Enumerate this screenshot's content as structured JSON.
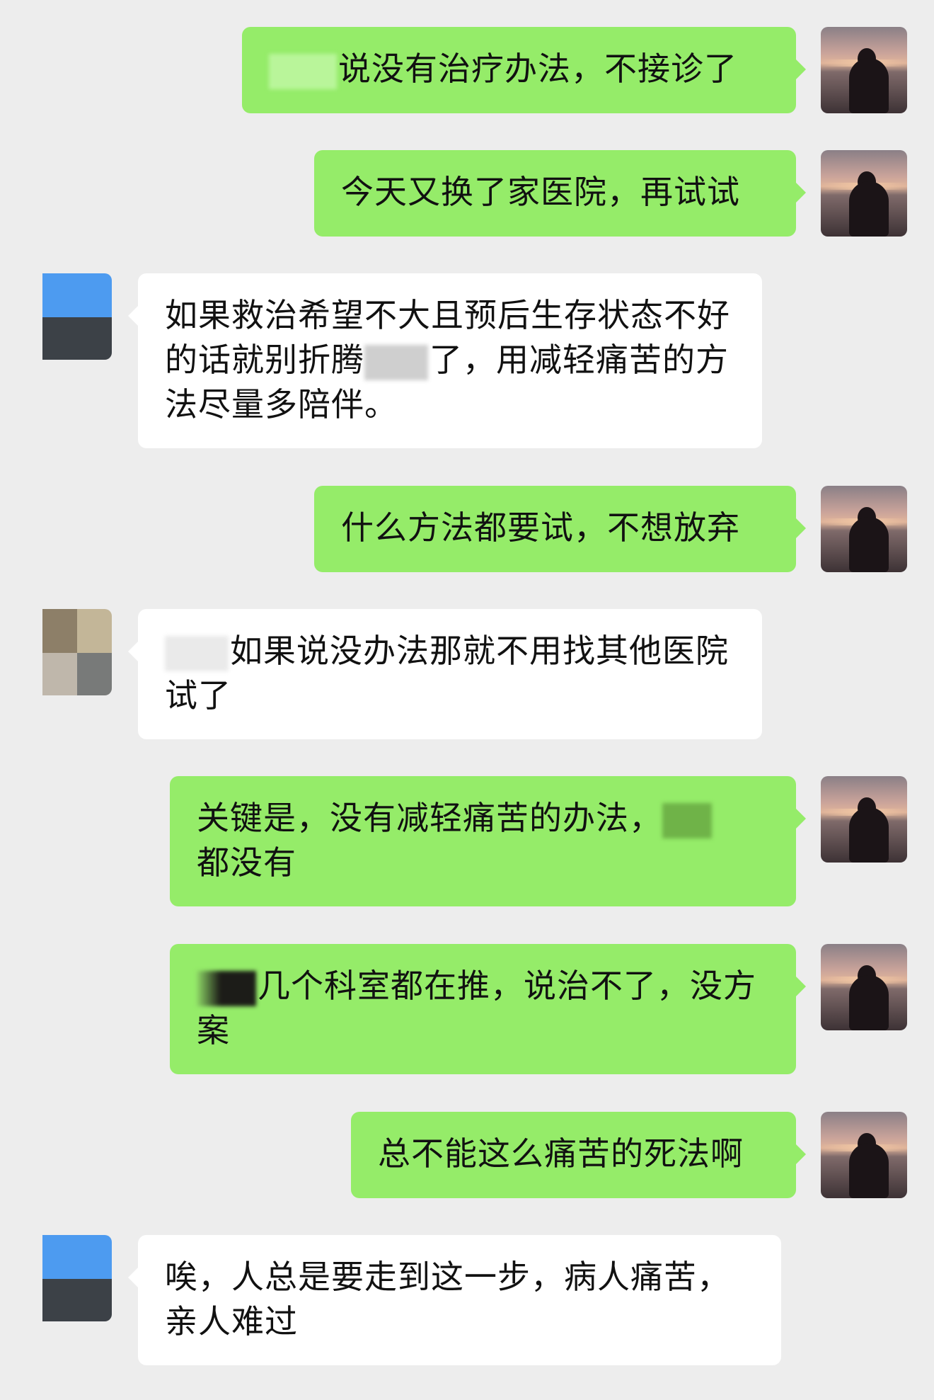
{
  "colors": {
    "background": "#ededed",
    "my_bubble": "#95ec69",
    "their_bubble": "#ffffff"
  },
  "messages": [
    {
      "sender": "me",
      "text": "说没有治疗办法，不接诊了",
      "redacted_prefix": true
    },
    {
      "sender": "me",
      "text": "今天又换了家医院，再试试"
    },
    {
      "sender": "other",
      "text_a": "如果救治希望不大且预后生存状态不好的话就别折腾",
      "text_b": "了，用减轻痛苦的方法尽量多陪伴。",
      "redacted_middle": true
    },
    {
      "sender": "me",
      "text": "什么方法都要试，不想放弃"
    },
    {
      "sender": "other",
      "text": "如果说没办法那就不用找其他医院试了",
      "redacted_prefix": true
    },
    {
      "sender": "me",
      "text_a": "关键是，没有减轻痛苦的办法，",
      "text_b": "都没有",
      "redacted_middle": true
    },
    {
      "sender": "me",
      "text": "几个科室都在推，说治不了，没方案",
      "redacted_prefix": true
    },
    {
      "sender": "me",
      "text": "总不能这么痛苦的死法啊"
    },
    {
      "sender": "other",
      "text": "唉，人总是要走到这一步，病人痛苦，亲人难过"
    }
  ]
}
